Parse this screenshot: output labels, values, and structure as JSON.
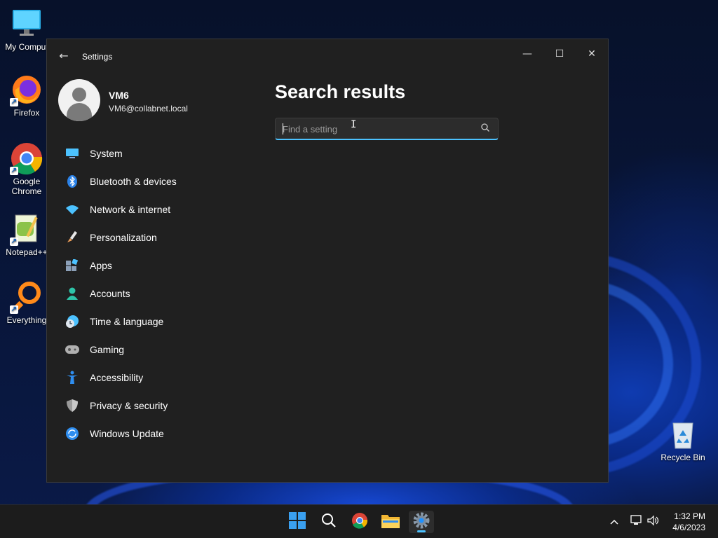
{
  "desktop": {
    "icons": [
      {
        "label": "My Comput",
        "icon": "monitor-icon"
      },
      {
        "label": "Firefox",
        "icon": "firefox-icon"
      },
      {
        "label": "Google Chrome",
        "icon": "chrome-icon"
      },
      {
        "label": "Notepad++",
        "icon": "notepadpp-icon"
      },
      {
        "label": "Everything",
        "icon": "everything-icon"
      },
      {
        "label": "Recycle Bin",
        "icon": "recycle-bin-icon"
      }
    ]
  },
  "window": {
    "title": "Settings",
    "controls": {
      "minimize": "—",
      "maximize": "☐",
      "close": "✕"
    },
    "back": "←"
  },
  "profile": {
    "name": "VM6",
    "email": "VM6@collabnet.local"
  },
  "nav": {
    "items": [
      {
        "label": "System",
        "icon": "system-icon",
        "color": "#4cc2ff"
      },
      {
        "label": "Bluetooth & devices",
        "icon": "bluetooth-icon",
        "color": "#3a8ef5"
      },
      {
        "label": "Network & internet",
        "icon": "wifi-icon",
        "color": "#4cc2ff"
      },
      {
        "label": "Personalization",
        "icon": "brush-icon",
        "color": "#f0a05a"
      },
      {
        "label": "Apps",
        "icon": "apps-icon",
        "color": "#8ca0b8"
      },
      {
        "label": "Accounts",
        "icon": "accounts-icon",
        "color": "#2ec4a8"
      },
      {
        "label": "Time & language",
        "icon": "globe-clock-icon",
        "color": "#4cc2ff"
      },
      {
        "label": "Gaming",
        "icon": "gamepad-icon",
        "color": "#b0b0b0"
      },
      {
        "label": "Accessibility",
        "icon": "accessibility-icon",
        "color": "#2f8ef0"
      },
      {
        "label": "Privacy & security",
        "icon": "shield-icon",
        "color": "#9a9a9a"
      },
      {
        "label": "Windows Update",
        "icon": "update-icon",
        "color": "#2f8ef0"
      }
    ]
  },
  "main": {
    "title": "Search results",
    "search": {
      "value": "",
      "placeholder": "Find a setting"
    }
  },
  "taskbar": {
    "apps": [
      "start-icon",
      "search-icon",
      "chrome-icon",
      "file-explorer-icon",
      "settings-icon"
    ],
    "tray": {
      "chevron": "^"
    },
    "time": "1:32 PM",
    "date": "4/6/2023"
  },
  "colors": {
    "accent": "#4cc2ff",
    "window_bg": "#202020",
    "taskbar_bg": "#1c1c1c"
  }
}
